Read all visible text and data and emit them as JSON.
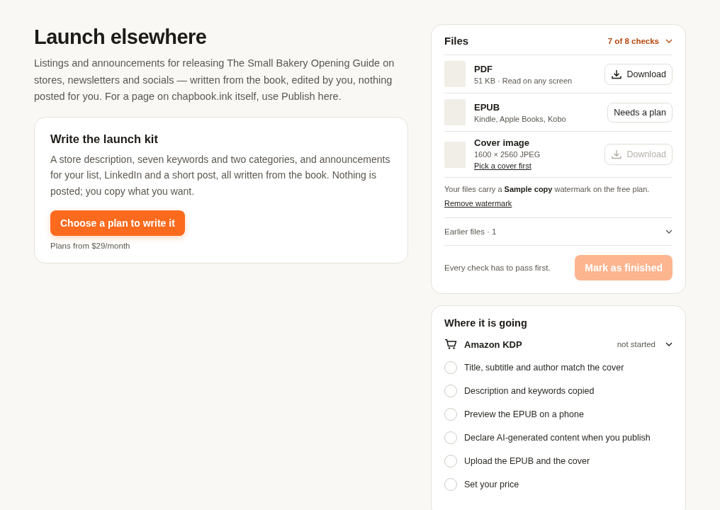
{
  "heading": "Launch elsewhere",
  "intro": "Listings and announcements for releasing The Small Bakery Opening Guide on stores, newsletters and socials — written from the book, edited by you, nothing posted for you. For a page on chapbook.ink itself, use Publish here.",
  "kit": {
    "title": "Write the launch kit",
    "text": "A store description, seven keywords and two categories, and announcements for your list, LinkedIn and a short post, all written from the book. Nothing is posted; you copy what you want.",
    "button": "Choose a plan to write it",
    "note": "Plans from $29/month"
  },
  "files": {
    "title": "Files",
    "checks": "7 of 8 checks",
    "expanded": false,
    "items": [
      {
        "name": "PDF",
        "meta": "51 KB · Read on any screen",
        "action": {
          "kind": "download",
          "label": "Download",
          "disabled": false
        }
      },
      {
        "name": "EPUB",
        "meta": "Kindle, Apple Books, Kobo",
        "action": {
          "kind": "plan",
          "label": "Needs a plan",
          "disabled": false
        }
      },
      {
        "name": "Cover image",
        "meta": "1600 × 2560 JPEG",
        "link": "Pick a cover first",
        "action": {
          "kind": "download",
          "label": "Download",
          "disabled": true
        }
      }
    ],
    "watermark_note": "Your files carry a **Sample copy** watermark on the free plan.",
    "watermark_link": "Remove watermark",
    "earlier": "Earlier files · 1",
    "earlier_expanded": false,
    "finish_note": "Every check has to pass first.",
    "finish_button": "Mark as finished",
    "finish_disabled": true
  },
  "destinations": {
    "title": "Where it is going",
    "items": [
      {
        "name": "Amazon KDP",
        "status": "not started",
        "expanded": true,
        "checks": [
          {
            "label": "Title, subtitle and author match the cover",
            "checked": false
          },
          {
            "label": "Description and keywords copied",
            "checked": false
          },
          {
            "label": "Preview the EPUB on a phone",
            "checked": false
          },
          {
            "label": "Declare AI-generated content when you publish",
            "checked": false
          },
          {
            "label": "Upload the EPUB and the cover",
            "checked": false
          },
          {
            "label": "Set your price",
            "checked": false
          }
        ]
      }
    ]
  }
}
